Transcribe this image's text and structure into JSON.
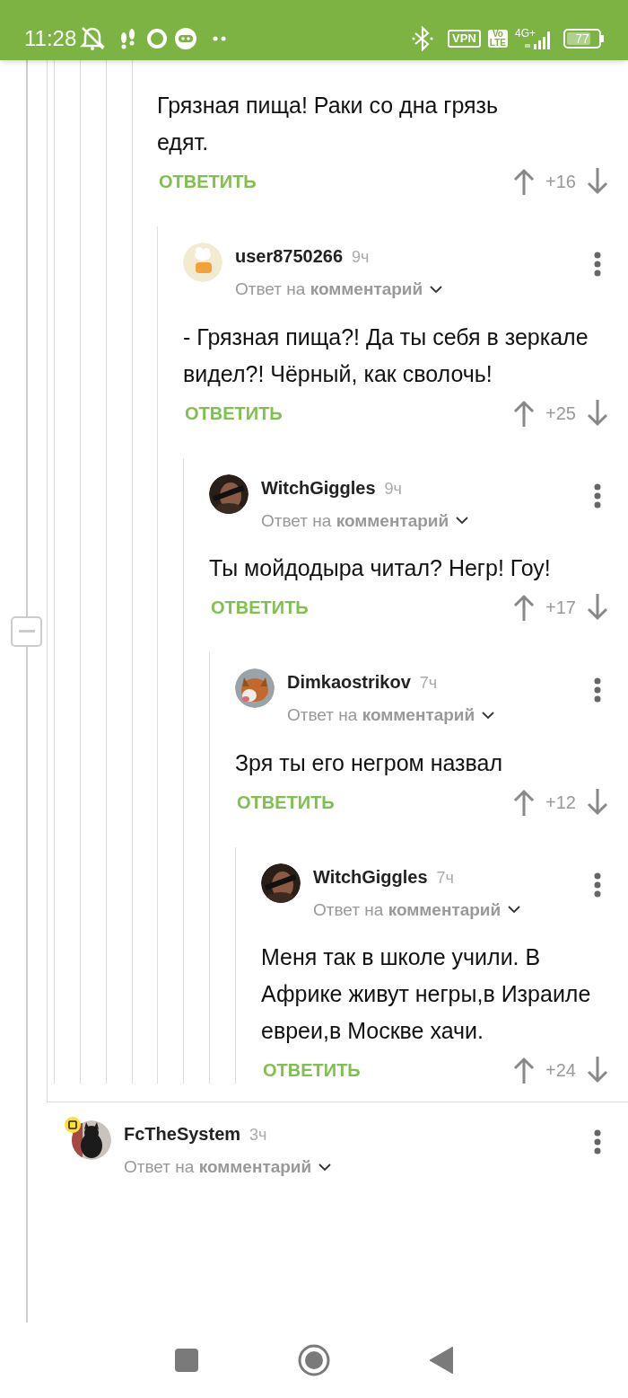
{
  "status_bar": {
    "time": "11:28",
    "vpn": "VPN",
    "volte_top": "Vo",
    "volte_bottom": "LTE",
    "network": "4G+",
    "battery": "77"
  },
  "thread": {
    "expanded": true,
    "nested_comments": [
      {
        "text": "Грязная пища! Раки со дна грязь едят.",
        "reply": "ОТВЕТИТЬ",
        "score": "+16",
        "children": [
          {
            "author": "user8750266",
            "time": "9ч",
            "reply_to": "Ответ на **комментарий**",
            "text": "- Грязная пища?! Да ты себя в зеркале видел?! Чёрный, как сволочь!",
            "reply": "ОТВЕТИТЬ",
            "score": "+25",
            "children": [
              {
                "author": "WitchGiggles",
                "time": "9ч",
                "reply_to": "Ответ на **комментарий**",
                "text": "Ты мойдодыра читал? Негр! Гоу!",
                "reply": "ОТВЕТИТЬ",
                "score": "+17",
                "children": [
                  {
                    "author": "Dimkaostrikov",
                    "time": "7ч",
                    "reply_to": "Ответ на **комментарий**",
                    "text": "Зря ты его негром назвал",
                    "reply": "ОТВЕТИТЬ",
                    "score": "+12",
                    "children": [
                      {
                        "author": "WitchGiggles",
                        "time": "7ч",
                        "reply_to": "Ответ на **комментарий**",
                        "text": "Меня так в школе учили. В Африке живут негры,в Израиле евреи,в Москве хачи.",
                        "reply": "ОТВЕТИТЬ",
                        "score": "+24"
                      }
                    ]
                  }
                ]
              }
            ]
          }
        ]
      }
    ],
    "comments_after": [
      {
        "author": "FcTheSystem",
        "time": "3ч",
        "badge": true,
        "reply_to": "Ответ на **комментарий**"
      }
    ]
  }
}
